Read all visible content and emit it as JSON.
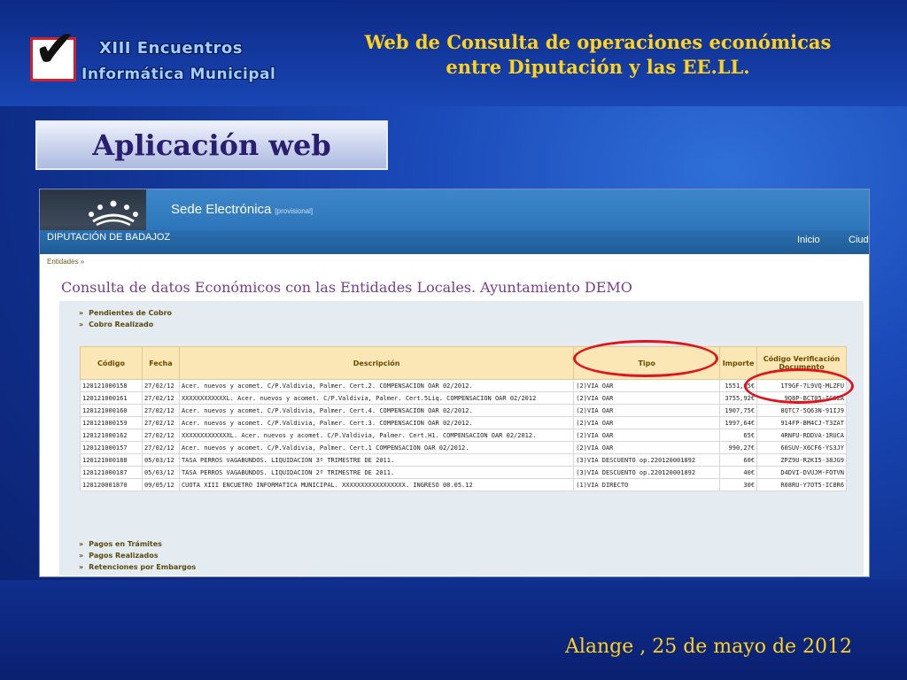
{
  "logo": {
    "line1": "XIII Encuentros",
    "line2": "Informática Municipal",
    "check": "✔"
  },
  "slide": {
    "title_line1": "Web  de Consulta de operaciones económicas",
    "title_line2": "entre Diputación y las EE.LL.",
    "banner": "Aplicación web",
    "footer": "Alange , 25 de mayo de 2012"
  },
  "site": {
    "name": "Sede Electrónica",
    "tag": "[provisional]",
    "org": "DIPUTACIÓN DE BADAJOZ",
    "nav": [
      "Inicio",
      "Ciud"
    ],
    "breadcrumb": "Entidades »",
    "page_title": "Consulta de datos Económicos con las Entidades Locales. Ayuntamiento DEMO"
  },
  "links_top": [
    "Pendientes de Cobro",
    "Cobro Realizado"
  ],
  "links_bottom": [
    "Pagos en Trámites",
    "Pagos Realizados",
    "Retenciones por Embargos"
  ],
  "table": {
    "headers": [
      "Código",
      "Fecha",
      "Descripción",
      "Tipo",
      "Importe",
      "Código Verificación Documento"
    ],
    "rows": [
      [
        "120121000158",
        "27/02/12",
        "Acer. nuevos y acomet. C/P.Valdivia, Palmer. Cert.2. COMPENSACION OAR 02/2012.",
        "(2)VIA OAR",
        "1551,65€",
        "1T9GF-7L9VQ-MLZFU"
      ],
      [
        "120121000161",
        "27/02/12",
        "XXXXXXXXXXXXL. Acer. nuevos y acomet. C/P.Valdivia, Palmer. Cert.5Liq. COMPENSACION OAR 02/2012",
        "(2)VIA OAR",
        "3755,92€",
        "9Q8P-BCT05-IC6ZA"
      ],
      [
        "120121000160",
        "27/02/12",
        "Acer. nuevos y acomet. C/P.Valdivia, Palmer. Cert.4. COMPENSACION OAR 02/2012.",
        "(2)VIA OAR",
        "1907,75€",
        "8QTC7-5Q63N-91IJ9"
      ],
      [
        "120121000159",
        "27/02/12",
        "Acer. nuevos y acomet. C/P.Valdivia, Palmer. Cert.3. COMPENSACION OAR 02/2012.",
        "(2)VIA OAR",
        "1997,64€",
        "914FP-BM4CJ-T3ZAT"
      ],
      [
        "120121000162",
        "27/02/12",
        "XXXXXXXXXXXXXL. Acer. nuevos y acomet. C/P.Valdivia, Palmer. Cert.H1. COMPENSACION OAR 02/2012.",
        "(2)VIA OAR",
        "65€",
        "4RNFU-RDDVA-1RUCA"
      ],
      [
        "120121000157",
        "27/02/12",
        "Acer. nuevos y acomet. C/P.Valdivia, Palmer. Cert.1 COMPENSACION OAR 02/2012.",
        "(2)VIA OAR",
        "990,27€",
        "60SUV-X6CF6-YS3JY"
      ],
      [
        "120121000188",
        "05/03/12",
        "TASA PERROS VAGABUNDOS. LIQUIDACION 3º TRIMESTRE DE 2011.",
        "(3)VIA DESCUENTO op.220120001892",
        "60€",
        "ZPZ9U-R2KI5-38JG9"
      ],
      [
        "120121000187",
        "05/03/12",
        "TASA PERROS VAGABUNDOS. LIQUIDACION 2º TRIMESTRE DE 2011.",
        "(3)VIA DESCUENTO op.220120001892",
        "40€",
        "D4DVI-DVUJM-FOTVN"
      ],
      [
        "120120001870",
        "09/05/12",
        "CUOTA XIII ENCUETRO INFORMATICA MUNICIPAL. XXXXXXXXXXXXXXXXX. INGRESO 08.05.12",
        "(1)VIA DIRECTO",
        "30€",
        "R08RU-Y7OT5-IC8R6"
      ]
    ]
  },
  "colors": {
    "slide_title": "#ffd21f",
    "highlight_oval": "#e0141c",
    "table_header_bg": "#fbe7b5"
  }
}
